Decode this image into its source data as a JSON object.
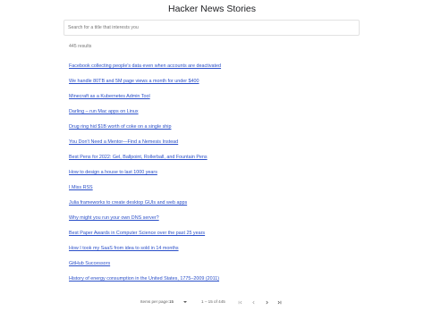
{
  "header": {
    "title": "Hacker News Stories"
  },
  "search": {
    "placeholder": "Search for a title that interests you",
    "value": ""
  },
  "results": {
    "count_text": "445 results",
    "items": [
      "Facebook collecting people's data even when accounts are deactivated",
      "We handle 80TB and 5M page views a month for under $400",
      "Minecraft as a Kubernetes Admin Tool",
      "Darling – run Mac apps on Linux",
      "Drug ring hid $1B worth of coke on a single ship",
      "You Don't Need a Mentor—Find a Nemesis Instead",
      "Best Pens for 2022: Gel, Ballpoint, Rollerball, and Fountain Pens",
      "How to design a house to last 1000 years",
      "I Miss RSS",
      "Julia frameworks to create desktop GUIs and web apps",
      "Why might you run your own DNS server?",
      "Best Paper Awards in Computer Science over the past 25 years",
      "How I took my SaaS from idea to sold in 14 months",
      "GitHub Successors",
      "History of energy consumption in the United States, 1775–2009 (2011)"
    ]
  },
  "pagination": {
    "rows_label": "Items per page:",
    "rows_value": "15",
    "range_text": "1 – 15 of 445"
  },
  "colors": {
    "link": "#2a4fc9",
    "border": "#e2e2e2"
  },
  "icons": {
    "first": "first-page-icon",
    "prev": "chevron-left-icon",
    "next": "chevron-right-icon",
    "last": "last-page-icon"
  }
}
